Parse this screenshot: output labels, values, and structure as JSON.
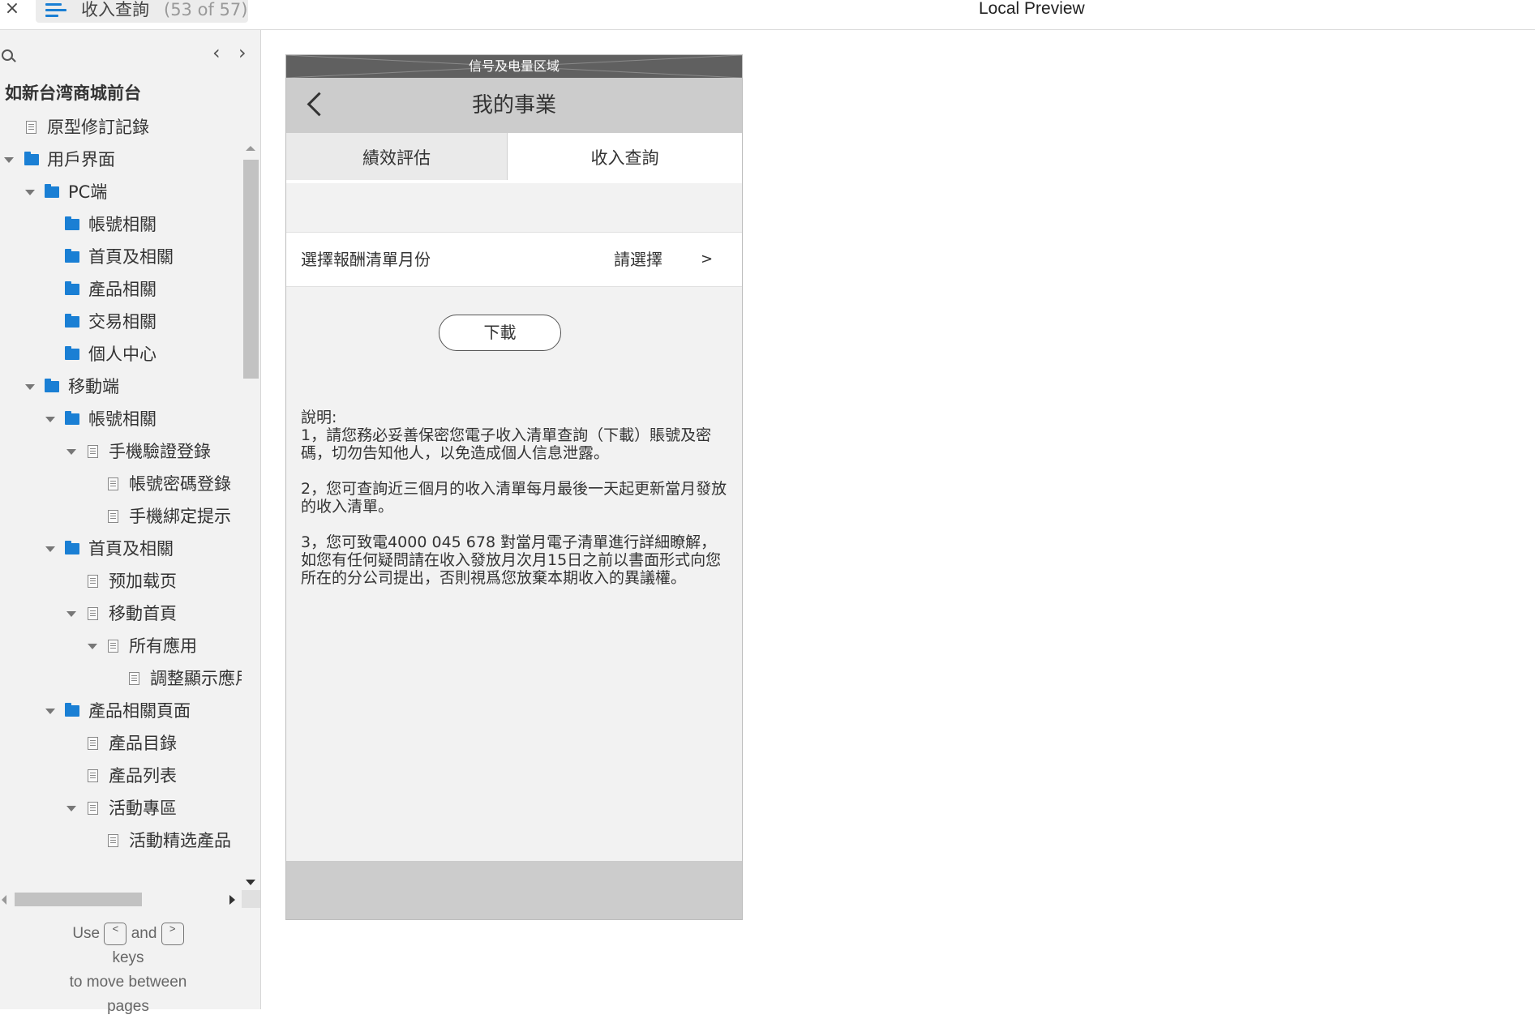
{
  "topbar": {
    "close_symbol": "×",
    "page_name": "收入查詢",
    "page_count": "(53 of 57)",
    "preview_title": "Local Preview"
  },
  "sidebar": {
    "prev_symbol": "‹",
    "next_symbol": "›",
    "project_title": "如新台湾商城前台",
    "tree": [
      {
        "label": "原型修訂記錄",
        "type": "page"
      },
      {
        "label": "用戶界面",
        "type": "folder",
        "expanded": true
      },
      {
        "label": "PC端",
        "type": "folder",
        "expanded": true
      },
      {
        "label": "帳號相關",
        "type": "folder"
      },
      {
        "label": "首頁及相關",
        "type": "folder"
      },
      {
        "label": "產品相關",
        "type": "folder"
      },
      {
        "label": "交易相關",
        "type": "folder"
      },
      {
        "label": "個人中心",
        "type": "folder"
      },
      {
        "label": "移動端",
        "type": "folder",
        "expanded": true
      },
      {
        "label": "帳號相關",
        "type": "folder",
        "expanded": true
      },
      {
        "label": "手機驗證登錄",
        "type": "page",
        "expanded": true
      },
      {
        "label": "帳號密碼登錄",
        "type": "page"
      },
      {
        "label": "手機綁定提示",
        "type": "page"
      },
      {
        "label": "首頁及相關",
        "type": "folder",
        "expanded": true
      },
      {
        "label": "预加载页",
        "type": "page"
      },
      {
        "label": "移動首頁",
        "type": "page",
        "expanded": true
      },
      {
        "label": "所有應用",
        "type": "page",
        "expanded": true
      },
      {
        "label": "調整顯示應用",
        "type": "page"
      },
      {
        "label": "產品相關頁面",
        "type": "folder",
        "expanded": true
      },
      {
        "label": "產品目錄",
        "type": "page"
      },
      {
        "label": "產品列表",
        "type": "page"
      },
      {
        "label": "活動專區",
        "type": "page",
        "expanded": true
      },
      {
        "label": "活動精选產品",
        "type": "page"
      }
    ],
    "hint": {
      "use": "Use",
      "key_prev": "<",
      "and": "and",
      "key_next": ">",
      "rest_1": "keys",
      "rest_2": "to move between",
      "rest_3": "pages"
    }
  },
  "phone": {
    "statusbar_label": "信号及电量区域",
    "nav_title": "我的事業",
    "tabs": [
      "績效評估",
      "收入查詢"
    ],
    "active_tab": 1,
    "select_row": {
      "label": "選擇報酬清單月份",
      "value": "請選擇",
      "arrow": ">"
    },
    "download_label": "下載",
    "notes": {
      "title": "說明:",
      "items": [
        "1，請您務必妥善保密您電子收入清單查詢（下載）賬號及密碼，切勿告知他人，以免造成個人信息泄露。",
        "2，您可查詢近三個月的收入清單每月最後一天起更新當月發放的收入清單。",
        "3，您可致電4000 045 678 對當月電子清單進行詳細瞭解，如您有任何疑問請在收入發放月次月15日之前以書面形式向您所在的分公司提出，否則視爲您放棄本期收入的異議權。"
      ]
    }
  },
  "colors": {
    "accent": "#1a7fd4",
    "sidebar_bg": "#f2f2f2",
    "phone_bg": "#f2f2f2",
    "navbar_bg": "#cccccc",
    "statusbar_bg": "#606060"
  }
}
